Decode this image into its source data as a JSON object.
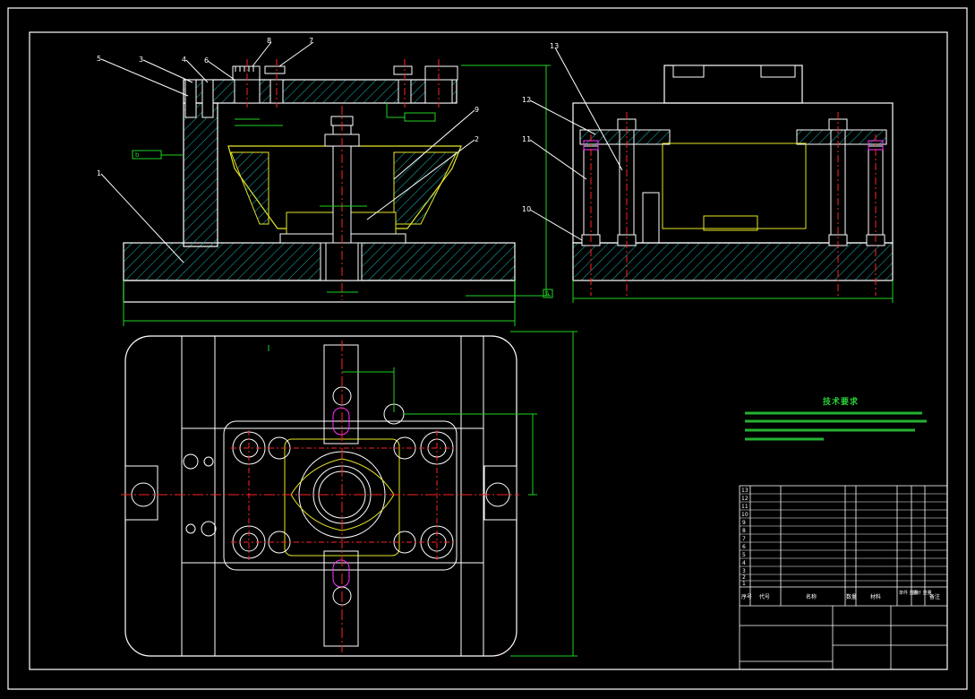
{
  "drawing": {
    "balloons": [
      "8",
      "7",
      "5",
      "3",
      "4",
      "6",
      "1",
      "9",
      "2",
      "13",
      "12",
      "11",
      "10"
    ],
    "datum_labels": [
      "b",
      "A"
    ],
    "tech_requirements_title": "技术要求"
  },
  "title_block": {
    "headers": [
      "序号",
      "代号",
      "名称",
      "数量",
      "材料",
      "单件 重量",
      "总计 重量",
      "备注"
    ],
    "rows": [
      {
        "no": "13"
      },
      {
        "no": "12"
      },
      {
        "no": "11"
      },
      {
        "no": "10"
      },
      {
        "no": "9"
      },
      {
        "no": "8"
      },
      {
        "no": "7"
      },
      {
        "no": "6"
      },
      {
        "no": "5"
      },
      {
        "no": "4"
      },
      {
        "no": "3"
      },
      {
        "no": "2"
      },
      {
        "no": "1"
      }
    ]
  },
  "colors": {
    "outline": "#ffffff",
    "hatch": "#19b8b8",
    "center": "#ff2222",
    "dim": "#1fd21f",
    "hidden": "#e6e626",
    "magenta": "#ff33ff"
  }
}
